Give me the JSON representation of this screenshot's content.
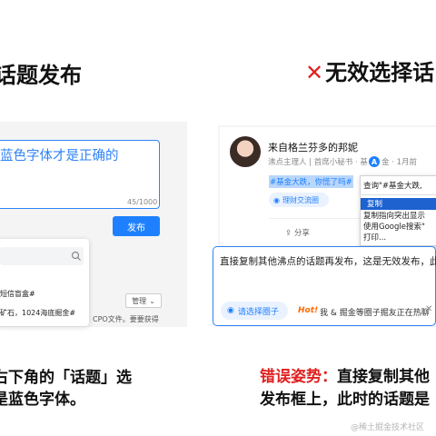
{
  "left": {
    "title": "话题发布",
    "textarea_text": "蓝色字体才是正确的",
    "counter": "45/1000",
    "publish_label": "发布",
    "dropdown_items": [
      "短信盲盒#",
      "矿石，1024海底掘金#",
      "CPO文件。要要获得"
    ],
    "manage_label": "管理",
    "caption_line1": "右下角的「话题」选",
    "caption_line2": "是蓝色字体。"
  },
  "right": {
    "title": "无效选择话",
    "author_name": "来自格兰芬多的邦妮",
    "author_meta": "沸点主理人 | 首席小秘书 · 基",
    "meta_badge": "A",
    "meta_tail": "金 · 1月前",
    "selected_topic": "#基金大跌，你慌了吗#",
    "circle_chip": "理财交流圈",
    "share_label": "分享",
    "context_menu": {
      "query": "查询\"#基金大跌,",
      "copy": "复制",
      "copy_link": "复制指向突出显示",
      "google": "使用Google搜索\"",
      "print": "打印..."
    },
    "editor_text": "直接复制其他沸点的话题再发布，这是无效发布，此时",
    "select_circle": "请选择圈子",
    "hot_label": "Hot!",
    "hot_text": "我 & 掘金等圈子掘友正在热聊",
    "caption_error": "错误姿势：",
    "caption_line1_rest": "直接复制其他",
    "caption_line2": "发布框上，此时的话题是"
  },
  "watermark": "@稀土掘金技术社区",
  "colors": {
    "accent": "#1e80ff",
    "error": "#e02020",
    "hot": "#ff6a00"
  }
}
